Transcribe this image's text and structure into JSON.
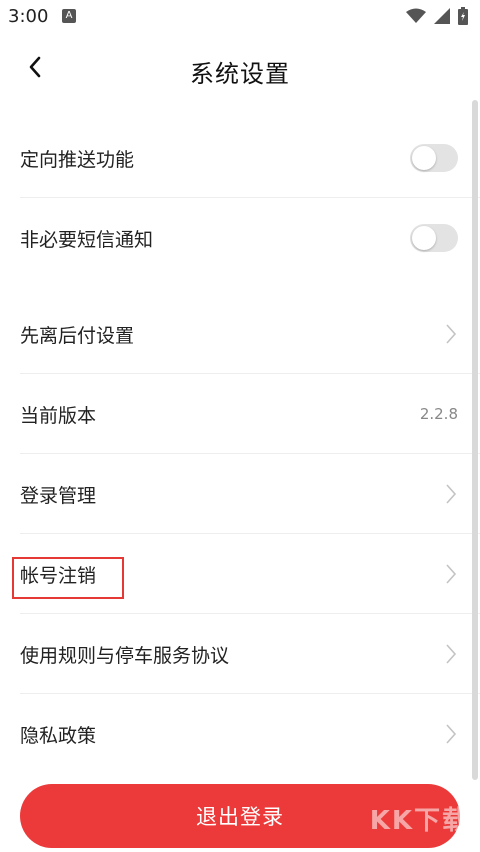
{
  "status_bar": {
    "time": "3:00",
    "indicator": "A",
    "icons": [
      "wifi-icon",
      "signal-icon",
      "battery-icon"
    ]
  },
  "header": {
    "title": "系统设置",
    "back_icon": "chevron-left-icon"
  },
  "settings": {
    "push_label": "定向推送功能",
    "sms_label": "非必要短信通知",
    "pay_later_label": "先离后付设置",
    "version_label": "当前版本",
    "version_value": "2.2.8",
    "login_mgmt_label": "登录管理",
    "account_cancel_label": "帐号注销",
    "rules_label": "使用规则与停车服务协议",
    "privacy_label": "隐私政策"
  },
  "toggles": {
    "push_enabled": false,
    "sms_enabled": false
  },
  "logout": {
    "label": "退出登录"
  },
  "watermark": "KK下载",
  "colors": {
    "accent": "#ec3a3a",
    "highlight": "#e53935",
    "toggle_off": "#e3e3e3"
  }
}
